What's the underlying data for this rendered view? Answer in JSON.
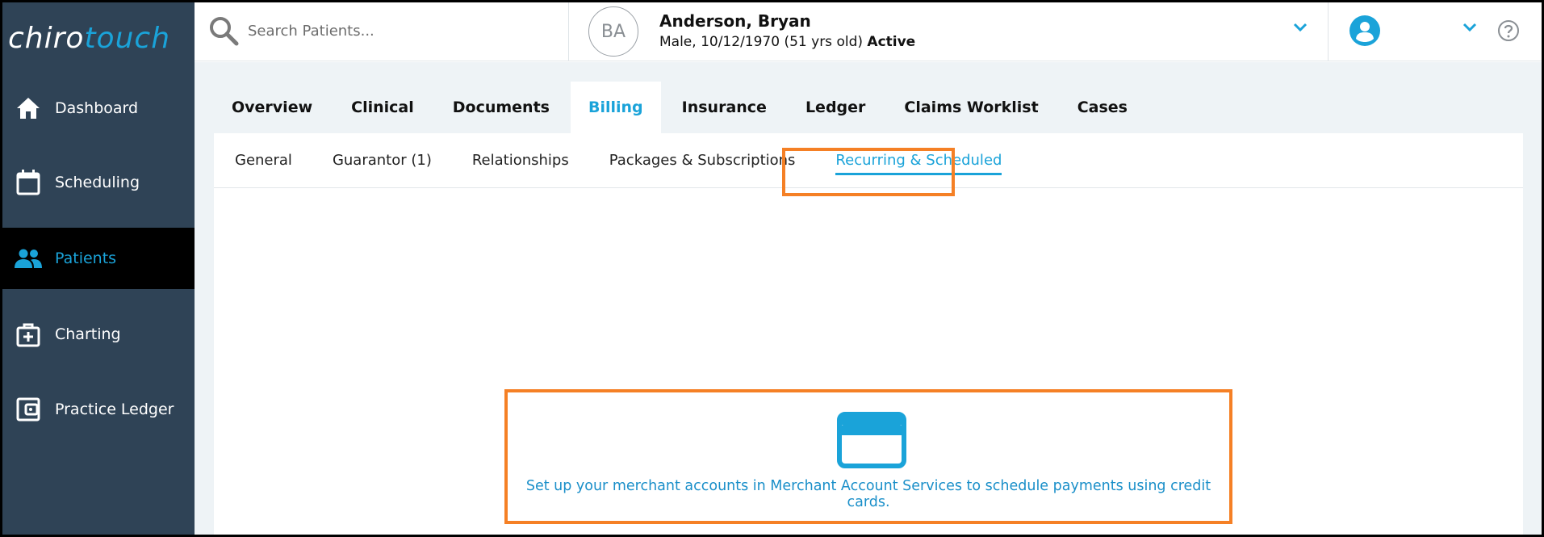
{
  "brand": {
    "logo_part1": "chiro",
    "logo_part2": "touch"
  },
  "sidebar": {
    "items": [
      {
        "label": "Dashboard",
        "icon": "home-icon"
      },
      {
        "label": "Scheduling",
        "icon": "calendar-icon"
      },
      {
        "label": "Patients",
        "icon": "people-icon",
        "active": true
      },
      {
        "label": "Charting",
        "icon": "medical-kit-icon"
      },
      {
        "label": "Practice Ledger",
        "icon": "wallet-icon"
      }
    ]
  },
  "search": {
    "placeholder": "Search Patients..."
  },
  "patient": {
    "initials": "BA",
    "name": "Anderson, Bryan",
    "details": "Male, 10/12/1970 (51 yrs old)",
    "status": "Active"
  },
  "main_tabs": [
    {
      "label": "Overview"
    },
    {
      "label": "Clinical"
    },
    {
      "label": "Documents"
    },
    {
      "label": "Billing",
      "active": true
    },
    {
      "label": "Insurance"
    },
    {
      "label": "Ledger"
    },
    {
      "label": "Claims Worklist"
    },
    {
      "label": "Cases"
    }
  ],
  "sub_tabs": [
    {
      "label": "General"
    },
    {
      "label": "Guarantor (1)"
    },
    {
      "label": "Relationships"
    },
    {
      "label": "Packages & Subscriptions"
    },
    {
      "label": "Recurring & Scheduled",
      "active": true
    }
  ],
  "message": {
    "icon": "credit-card-icon",
    "text": "Set up your merchant accounts in Merchant Account Services to schedule payments using credit cards."
  },
  "colors": {
    "sidebar_bg": "#2f4356",
    "accent": "#1aa3d9",
    "highlight": "#f58025"
  }
}
